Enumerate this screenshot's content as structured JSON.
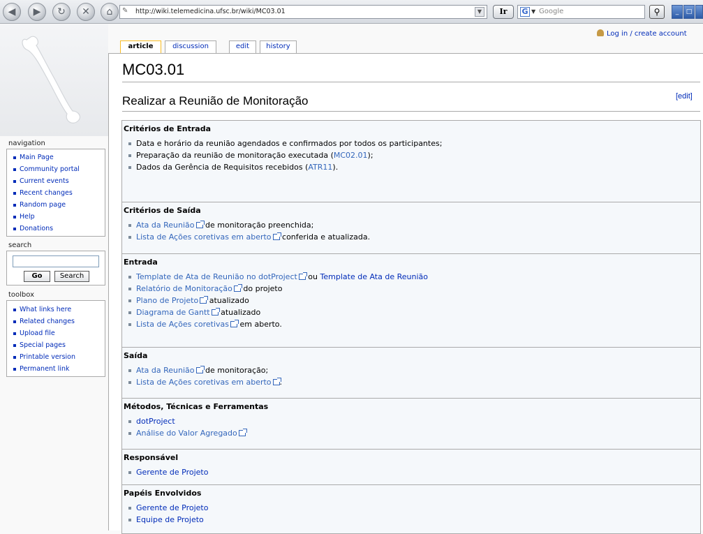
{
  "browser": {
    "url": "http://wiki.telemedicina.ufsc.br/wiki/MC03.01",
    "go_button": "Ir",
    "search_placeholder": "Google"
  },
  "user_links": {
    "login": "Log in / create account"
  },
  "tabs": [
    {
      "label": "article",
      "selected": true
    },
    {
      "label": "discussion"
    },
    {
      "label": "edit"
    },
    {
      "label": "history"
    }
  ],
  "sidebar": {
    "navigation": {
      "title": "navigation",
      "items": [
        "Main Page",
        "Community portal",
        "Current events",
        "Recent changes",
        "Random page",
        "Help",
        "Donations"
      ]
    },
    "search": {
      "title": "search",
      "go": "Go",
      "search": "Search"
    },
    "toolbox": {
      "title": "toolbox",
      "items": [
        "What links here",
        "Related changes",
        "Upload file",
        "Special pages",
        "Printable version",
        "Permanent link"
      ]
    }
  },
  "page": {
    "title": "MC03.01",
    "heading": "Realizar a Reunião de Monitoração",
    "edit_link": "[edit]"
  },
  "sections": {
    "entrada_criteria": {
      "heading": "Critérios de Entrada",
      "i1": "Data e horário da reunião agendados e confirmados por todos os participantes;",
      "i2_pre": "Preparação da reunião de monitoração executada (",
      "i2_link": "MC02.01",
      "i2_post": ");",
      "i3_pre": "Dados da Gerência de Requisitos recebidos (",
      "i3_link": "ATR11",
      "i3_post": ")."
    },
    "saida_criteria": {
      "heading": "Critérios de Saída",
      "i1_link": "Ata da Reunião",
      "i1_post": " de monitoração preenchida;",
      "i2_link": "Lista de Ações coretivas em aberto",
      "i2_post": " conferida e atualizada."
    },
    "entrada": {
      "heading": "Entrada",
      "i1_link": "Template de Ata de Reunião no dotProject",
      "i1_mid": " ou ",
      "i1_link2": "Template de Ata de Reunião",
      "i2_link": "Relatório de Monitoração",
      "i2_post": " do projeto",
      "i3_link": "Plano de Projeto",
      "i3_post": " atualizado",
      "i4_link": "Diagrama de Gantt",
      "i4_post": " atualizado",
      "i5_link": "Lista de Ações coretivas",
      "i5_post": " em aberto."
    },
    "saida": {
      "heading": "Saída",
      "i1_link": "Ata da Reunião",
      "i1_post": " de monitoração;",
      "i2_link": "Lista de Ações coretivas em aberto",
      "i2_post": "."
    },
    "metodos": {
      "heading": "Métodos, Técnicas e Ferramentas",
      "i1_link": "dotProject",
      "i2_link": "Análise do Valor Agregado"
    },
    "responsavel": {
      "heading": "Responsável",
      "i1_link": "Gerente de Projeto"
    },
    "papeis": {
      "heading": "Papéis Envolvidos",
      "i1_link": "Gerente de Projeto",
      "i2_link": "Equipe de Projeto"
    }
  }
}
